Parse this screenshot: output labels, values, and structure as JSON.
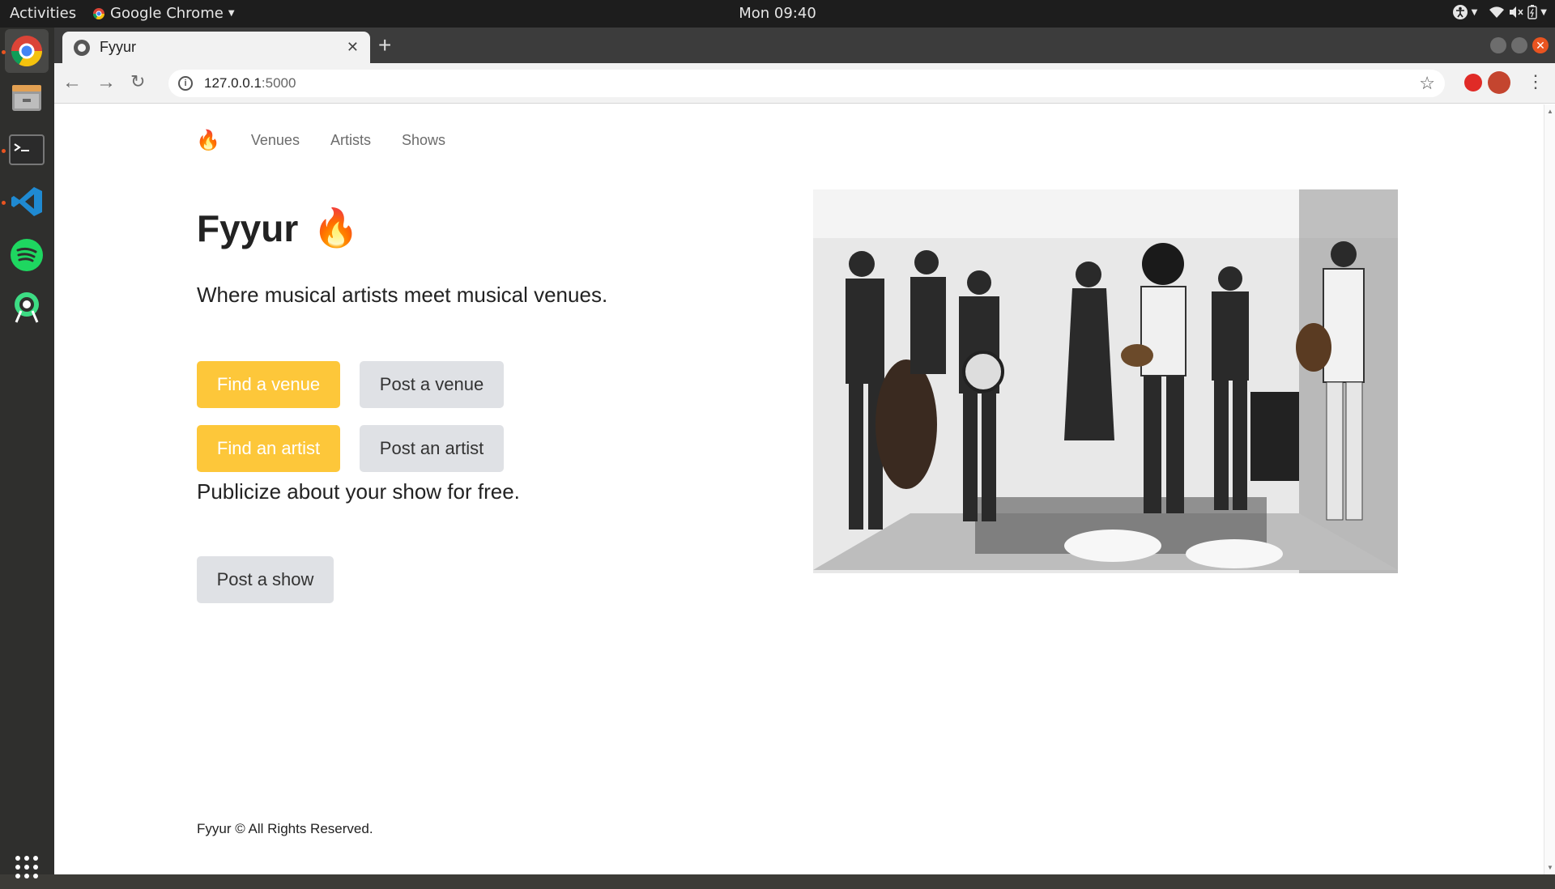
{
  "topbar": {
    "activities": "Activities",
    "app_name": "Google Chrome",
    "clock": "Mon 09:40"
  },
  "browser": {
    "tab_title": "Fyyur",
    "url_host": "127.0.0.1",
    "url_port": ":5000",
    "extensions": [
      "adblock-icon",
      "zip-icon",
      "extension-icon"
    ]
  },
  "site": {
    "nav": {
      "brand": "🔥",
      "items": [
        "Venues",
        "Artists",
        "Shows"
      ]
    },
    "heading": "Fyyur",
    "heading_emoji": "🔥",
    "tagline": "Where musical artists meet musical venues.",
    "buttons": {
      "find_venue": "Find a venue",
      "post_venue": "Post a venue",
      "find_artist": "Find an artist",
      "post_artist": "Post an artist",
      "post_show": "Post a show"
    },
    "publicize": "Publicize about your show for free.",
    "footer": "Fyyur © All Rights Reserved.",
    "colors": {
      "warning": "#fdc73a",
      "light": "#dfe1e5"
    }
  }
}
